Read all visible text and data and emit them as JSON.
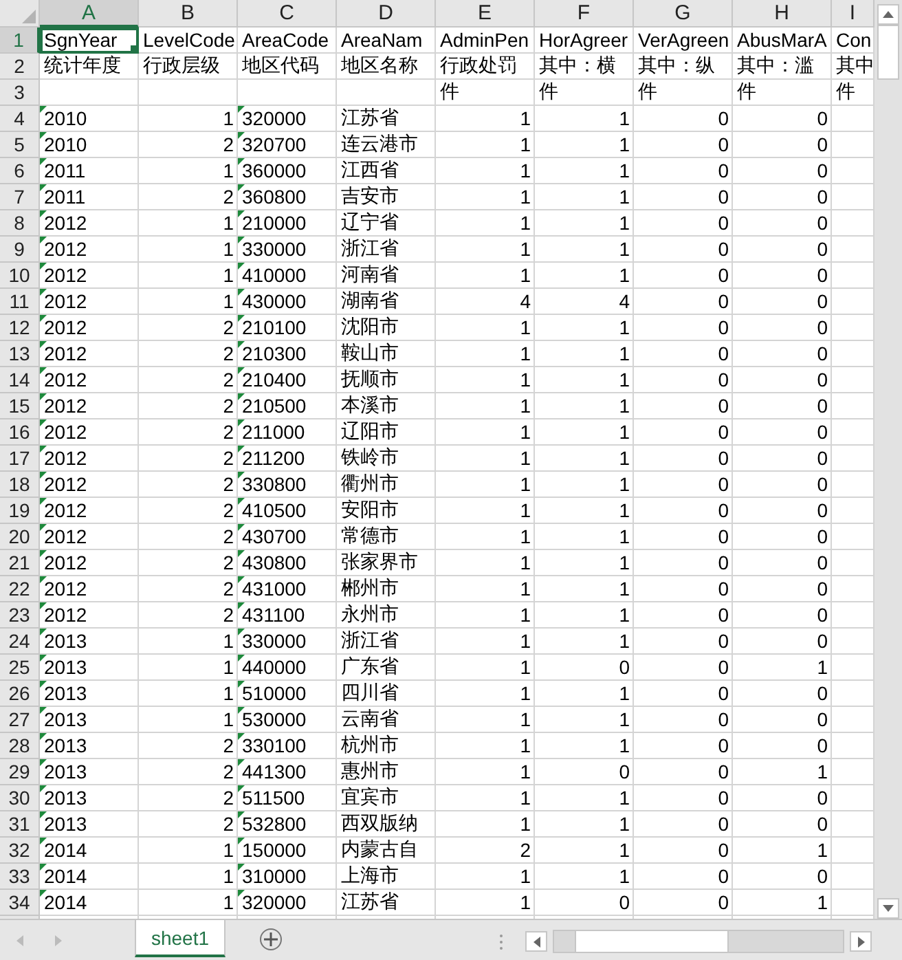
{
  "columns": [
    {
      "letter": "A",
      "kind": "text",
      "selected": true
    },
    {
      "letter": "B",
      "kind": "number",
      "selected": false
    },
    {
      "letter": "C",
      "kind": "text",
      "selected": false
    },
    {
      "letter": "D",
      "kind": "name",
      "selected": false
    },
    {
      "letter": "E",
      "kind": "number",
      "selected": false
    },
    {
      "letter": "F",
      "kind": "number",
      "selected": false
    },
    {
      "letter": "G",
      "kind": "number",
      "selected": false
    },
    {
      "letter": "H",
      "kind": "number",
      "selected": false
    },
    {
      "letter": "I",
      "kind": "number",
      "selected": false
    }
  ],
  "rows": [
    {
      "number": "1",
      "kind": "label",
      "selected": true,
      "cells": [
        "SgnYear",
        "LevelCode",
        "AreaCode",
        "AreaNam",
        "AdminPen",
        "HorAgreer",
        "VerAgreen",
        "AbusMarA",
        "Con"
      ]
    },
    {
      "number": "2",
      "kind": "label",
      "selected": false,
      "cells": [
        "统计年度",
        "行政层级",
        "地区代码",
        "地区名称",
        "行政处罚",
        "其中：横",
        "其中：纵",
        "其中：滥",
        "其中"
      ]
    },
    {
      "number": "3",
      "kind": "label",
      "selected": false,
      "cells": [
        null,
        null,
        null,
        null,
        "件",
        "件",
        "件",
        "件",
        "件"
      ]
    },
    {
      "number": "4",
      "kind": "data",
      "selected": false,
      "cells": [
        "2010",
        "1",
        "320000",
        "江苏省",
        "1",
        "1",
        "0",
        "0",
        null
      ]
    },
    {
      "number": "5",
      "kind": "data",
      "selected": false,
      "cells": [
        "2010",
        "2",
        "320700",
        "连云港市",
        "1",
        "1",
        "0",
        "0",
        null
      ]
    },
    {
      "number": "6",
      "kind": "data",
      "selected": false,
      "cells": [
        "2011",
        "1",
        "360000",
        "江西省",
        "1",
        "1",
        "0",
        "0",
        null
      ]
    },
    {
      "number": "7",
      "kind": "data",
      "selected": false,
      "cells": [
        "2011",
        "2",
        "360800",
        "吉安市",
        "1",
        "1",
        "0",
        "0",
        null
      ]
    },
    {
      "number": "8",
      "kind": "data",
      "selected": false,
      "cells": [
        "2012",
        "1",
        "210000",
        "辽宁省",
        "1",
        "1",
        "0",
        "0",
        null
      ]
    },
    {
      "number": "9",
      "kind": "data",
      "selected": false,
      "cells": [
        "2012",
        "1",
        "330000",
        "浙江省",
        "1",
        "1",
        "0",
        "0",
        null
      ]
    },
    {
      "number": "10",
      "kind": "data",
      "selected": false,
      "cells": [
        "2012",
        "1",
        "410000",
        "河南省",
        "1",
        "1",
        "0",
        "0",
        null
      ]
    },
    {
      "number": "11",
      "kind": "data",
      "selected": false,
      "cells": [
        "2012",
        "1",
        "430000",
        "湖南省",
        "4",
        "4",
        "0",
        "0",
        null
      ]
    },
    {
      "number": "12",
      "kind": "data",
      "selected": false,
      "cells": [
        "2012",
        "2",
        "210100",
        "沈阳市",
        "1",
        "1",
        "0",
        "0",
        null
      ]
    },
    {
      "number": "13",
      "kind": "data",
      "selected": false,
      "cells": [
        "2012",
        "2",
        "210300",
        "鞍山市",
        "1",
        "1",
        "0",
        "0",
        null
      ]
    },
    {
      "number": "14",
      "kind": "data",
      "selected": false,
      "cells": [
        "2012",
        "2",
        "210400",
        "抚顺市",
        "1",
        "1",
        "0",
        "0",
        null
      ]
    },
    {
      "number": "15",
      "kind": "data",
      "selected": false,
      "cells": [
        "2012",
        "2",
        "210500",
        "本溪市",
        "1",
        "1",
        "0",
        "0",
        null
      ]
    },
    {
      "number": "16",
      "kind": "data",
      "selected": false,
      "cells": [
        "2012",
        "2",
        "211000",
        "辽阳市",
        "1",
        "1",
        "0",
        "0",
        null
      ]
    },
    {
      "number": "17",
      "kind": "data",
      "selected": false,
      "cells": [
        "2012",
        "2",
        "211200",
        "铁岭市",
        "1",
        "1",
        "0",
        "0",
        null
      ]
    },
    {
      "number": "18",
      "kind": "data",
      "selected": false,
      "cells": [
        "2012",
        "2",
        "330800",
        "衢州市",
        "1",
        "1",
        "0",
        "0",
        null
      ]
    },
    {
      "number": "19",
      "kind": "data",
      "selected": false,
      "cells": [
        "2012",
        "2",
        "410500",
        "安阳市",
        "1",
        "1",
        "0",
        "0",
        null
      ]
    },
    {
      "number": "20",
      "kind": "data",
      "selected": false,
      "cells": [
        "2012",
        "2",
        "430700",
        "常德市",
        "1",
        "1",
        "0",
        "0",
        null
      ]
    },
    {
      "number": "21",
      "kind": "data",
      "selected": false,
      "cells": [
        "2012",
        "2",
        "430800",
        "张家界市",
        "1",
        "1",
        "0",
        "0",
        null
      ]
    },
    {
      "number": "22",
      "kind": "data",
      "selected": false,
      "cells": [
        "2012",
        "2",
        "431000",
        "郴州市",
        "1",
        "1",
        "0",
        "0",
        null
      ]
    },
    {
      "number": "23",
      "kind": "data",
      "selected": false,
      "cells": [
        "2012",
        "2",
        "431100",
        "永州市",
        "1",
        "1",
        "0",
        "0",
        null
      ]
    },
    {
      "number": "24",
      "kind": "data",
      "selected": false,
      "cells": [
        "2013",
        "1",
        "330000",
        "浙江省",
        "1",
        "1",
        "0",
        "0",
        null
      ]
    },
    {
      "number": "25",
      "kind": "data",
      "selected": false,
      "cells": [
        "2013",
        "1",
        "440000",
        "广东省",
        "1",
        "0",
        "0",
        "1",
        null
      ]
    },
    {
      "number": "26",
      "kind": "data",
      "selected": false,
      "cells": [
        "2013",
        "1",
        "510000",
        "四川省",
        "1",
        "1",
        "0",
        "0",
        null
      ]
    },
    {
      "number": "27",
      "kind": "data",
      "selected": false,
      "cells": [
        "2013",
        "1",
        "530000",
        "云南省",
        "1",
        "1",
        "0",
        "0",
        null
      ]
    },
    {
      "number": "28",
      "kind": "data",
      "selected": false,
      "cells": [
        "2013",
        "2",
        "330100",
        "杭州市",
        "1",
        "1",
        "0",
        "0",
        null
      ]
    },
    {
      "number": "29",
      "kind": "data",
      "selected": false,
      "cells": [
        "2013",
        "2",
        "441300",
        "惠州市",
        "1",
        "0",
        "0",
        "1",
        null
      ]
    },
    {
      "number": "30",
      "kind": "data",
      "selected": false,
      "cells": [
        "2013",
        "2",
        "511500",
        "宜宾市",
        "1",
        "1",
        "0",
        "0",
        null
      ]
    },
    {
      "number": "31",
      "kind": "data",
      "selected": false,
      "cells": [
        "2013",
        "2",
        "532800",
        "西双版纳",
        "1",
        "1",
        "0",
        "0",
        null
      ]
    },
    {
      "number": "32",
      "kind": "data",
      "selected": false,
      "cells": [
        "2014",
        "1",
        "150000",
        "内蒙古自",
        "2",
        "1",
        "0",
        "1",
        null
      ]
    },
    {
      "number": "33",
      "kind": "data",
      "selected": false,
      "cells": [
        "2014",
        "1",
        "310000",
        "上海市",
        "1",
        "1",
        "0",
        "0",
        null
      ]
    },
    {
      "number": "34",
      "kind": "data",
      "selected": false,
      "cells": [
        "2014",
        "1",
        "320000",
        "江苏省",
        "1",
        "0",
        "0",
        "1",
        null
      ]
    }
  ],
  "sheet_tabs": [
    {
      "label": "sheet1",
      "selected": true
    }
  ]
}
